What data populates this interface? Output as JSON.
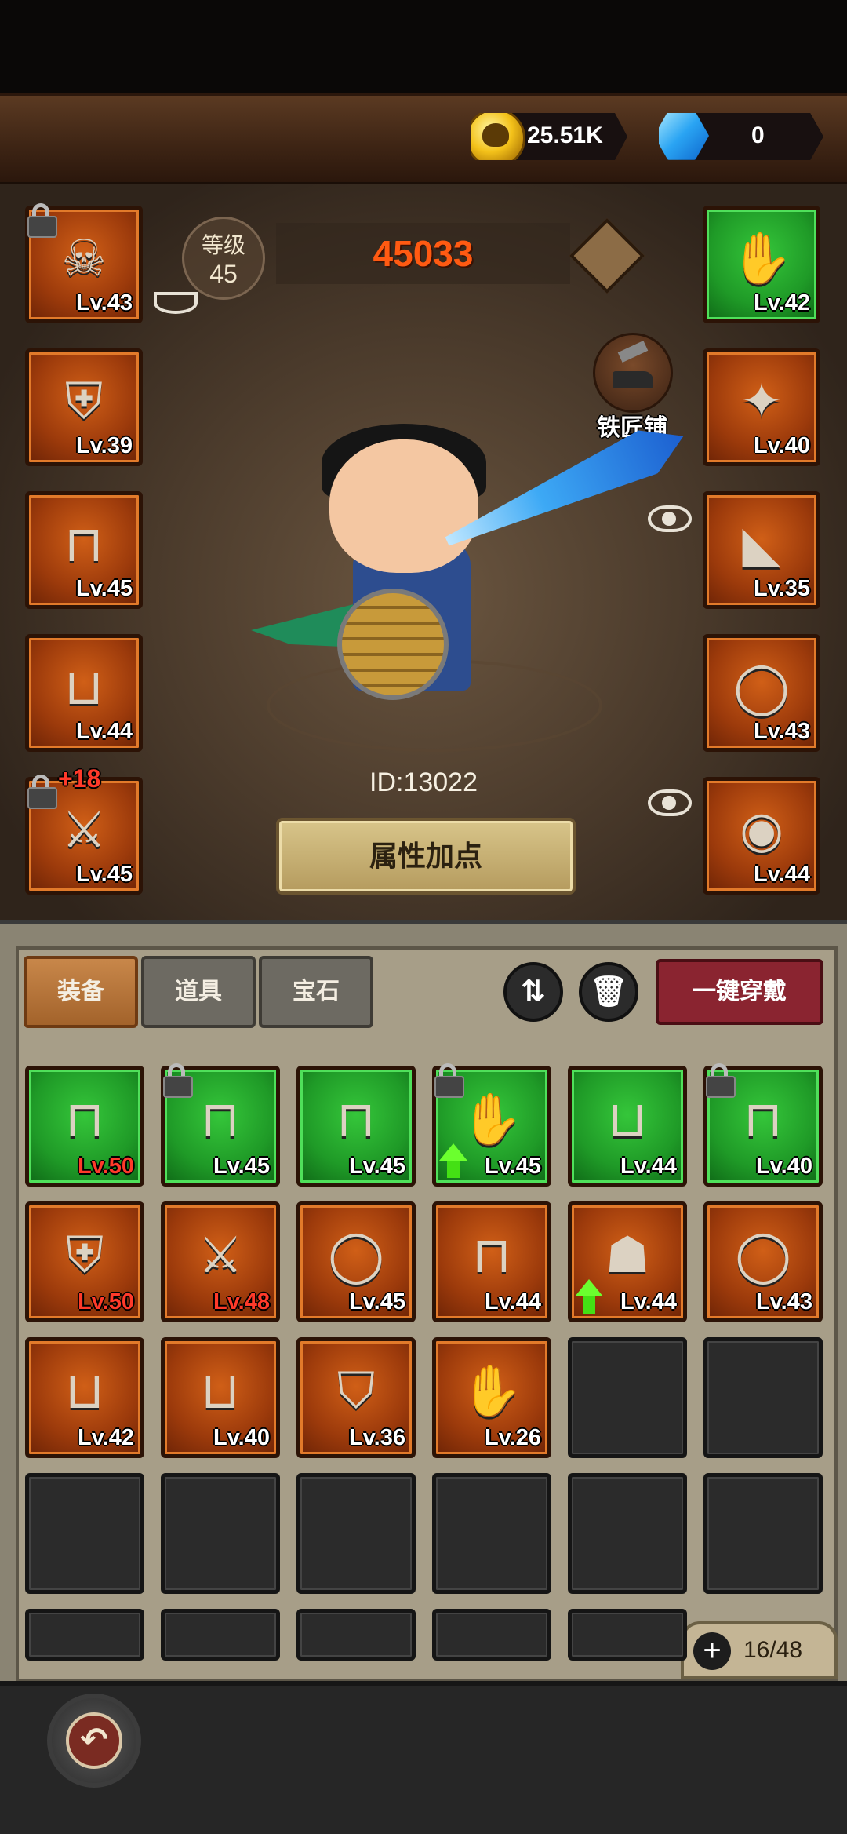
{
  "currency": {
    "gold": "25.51K",
    "gems": "0",
    "gold_icon": "skull-coin-icon",
    "gem_icon": "blue-gem-icon"
  },
  "hero": {
    "level_label": "等级",
    "level": "45",
    "power": "45033",
    "player_id": "ID:13022",
    "attr_button": "属性加点",
    "blacksmith_label": "铁匠铺",
    "enhance_bonus": "+18"
  },
  "equipped_left": [
    {
      "name": "skull-helmet",
      "level": "Lv.43",
      "locked": true,
      "glyph": "☠"
    },
    {
      "name": "shoulder-armor",
      "level": "Lv.39",
      "locked": false,
      "glyph": "⛨"
    },
    {
      "name": "red-pants",
      "level": "Lv.45",
      "locked": false,
      "glyph": "⊓"
    },
    {
      "name": "boots",
      "level": "Lv.44",
      "locked": false,
      "glyph": "⊔"
    },
    {
      "name": "ice-sword",
      "level": "Lv.45",
      "locked": true,
      "glyph": "⚔"
    }
  ],
  "equipped_right": [
    {
      "name": "steel-gauntlet",
      "level": "Lv.42",
      "green": true,
      "glyph": "✋"
    },
    {
      "name": "ruby-necklace",
      "level": "Lv.40",
      "green": false,
      "glyph": "✦"
    },
    {
      "name": "green-cape",
      "level": "Lv.35",
      "green": false,
      "glyph": "◣"
    },
    {
      "name": "jade-ring",
      "level": "Lv.43",
      "green": false,
      "glyph": "◯"
    },
    {
      "name": "wooden-shield",
      "level": "Lv.44",
      "green": false,
      "glyph": "◉"
    }
  ],
  "tabs": [
    "装备",
    "道具",
    "宝石"
  ],
  "equip_all_button": "一键穿戴",
  "inventory_items": [
    {
      "level": "Lv.50",
      "green": true,
      "red": true,
      "lock": false,
      "up": false,
      "glyph": "⊓"
    },
    {
      "level": "Lv.45",
      "green": true,
      "red": false,
      "lock": true,
      "up": false,
      "glyph": "⊓"
    },
    {
      "level": "Lv.45",
      "green": true,
      "red": false,
      "lock": false,
      "up": false,
      "glyph": "⊓"
    },
    {
      "level": "Lv.45",
      "green": true,
      "red": false,
      "lock": true,
      "up": true,
      "glyph": "✋"
    },
    {
      "level": "Lv.44",
      "green": true,
      "red": false,
      "lock": false,
      "up": false,
      "glyph": "⊔"
    },
    {
      "level": "Lv.40",
      "green": true,
      "red": false,
      "lock": true,
      "up": false,
      "glyph": "⊓"
    },
    {
      "level": "Lv.50",
      "green": false,
      "red": true,
      "lock": false,
      "up": false,
      "glyph": "⛨"
    },
    {
      "level": "Lv.48",
      "green": false,
      "red": true,
      "lock": false,
      "up": false,
      "glyph": "⚔"
    },
    {
      "level": "Lv.45",
      "green": false,
      "red": false,
      "lock": false,
      "up": false,
      "glyph": "◯"
    },
    {
      "level": "Lv.44",
      "green": false,
      "red": false,
      "lock": false,
      "up": false,
      "glyph": "⊓"
    },
    {
      "level": "Lv.44",
      "green": false,
      "red": false,
      "lock": false,
      "up": true,
      "glyph": "☗"
    },
    {
      "level": "Lv.43",
      "green": false,
      "red": false,
      "lock": false,
      "up": false,
      "glyph": "◯"
    },
    {
      "level": "Lv.42",
      "green": false,
      "red": false,
      "lock": false,
      "up": false,
      "glyph": "⊔"
    },
    {
      "level": "Lv.40",
      "green": false,
      "red": false,
      "lock": false,
      "up": false,
      "glyph": "⊔"
    },
    {
      "level": "Lv.36",
      "green": false,
      "red": false,
      "lock": false,
      "up": false,
      "glyph": "⛉"
    },
    {
      "level": "Lv.26",
      "green": false,
      "red": false,
      "lock": false,
      "up": false,
      "glyph": "✋"
    }
  ],
  "capacity": "16/48"
}
